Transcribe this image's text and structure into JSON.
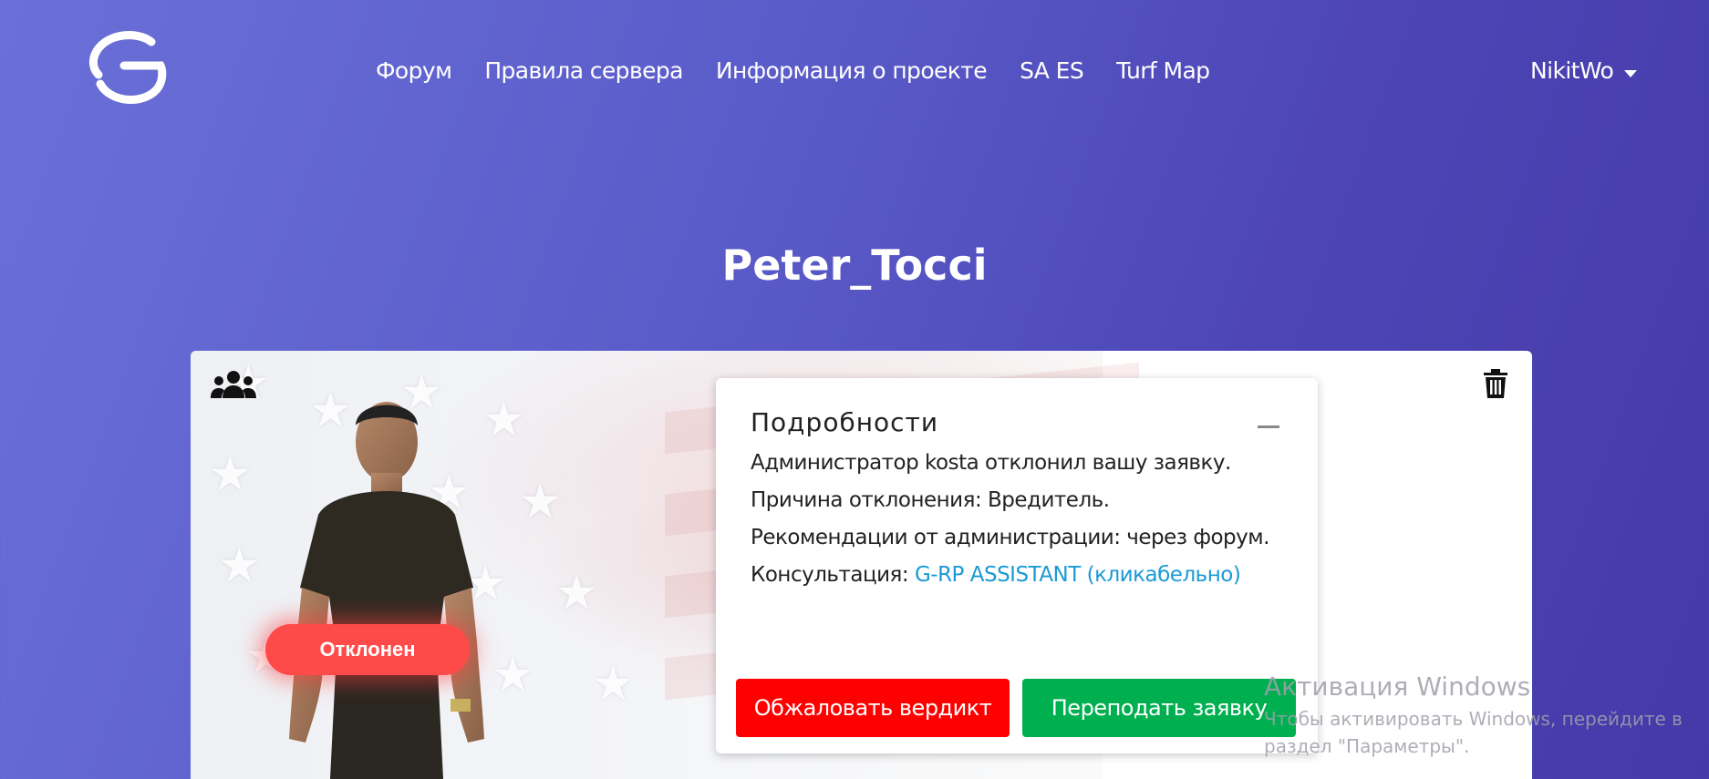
{
  "header": {
    "nav": [
      "Форум",
      "Правила сервера",
      "Информация о проекте",
      "SA ES",
      "Turf Map"
    ],
    "username": "NikitWo"
  },
  "page_title": "Peter_Tocci",
  "card": {
    "status": "Отклонен",
    "details": {
      "title": "Подробности",
      "line1": "Администратор kosta отклонил вашу заявку.",
      "line2": "Причина отклонения: Вредитель.",
      "line3": "Рекомендации от администрации: через форум.",
      "line4_prefix": "Консультация: ",
      "line4_link": "G-RP ASSISTANT (кликабельно)"
    },
    "buttons": {
      "appeal": "Обжаловать вердикт",
      "resubmit": "Переподать заявку"
    }
  },
  "watermark": {
    "title": "Активация Windows",
    "line1": "Чтобы активировать Windows, перейдите в",
    "line2": "раздел \"Параметры\"."
  },
  "colors": {
    "status_rejected": "#ff4a4a",
    "appeal_button": "#ff0000",
    "resubmit_button": "#00b050",
    "link": "#1a9ad6"
  },
  "icons": [
    "logo-icon",
    "caret-down-icon",
    "group-icon",
    "trash-icon",
    "collapse-icon"
  ]
}
